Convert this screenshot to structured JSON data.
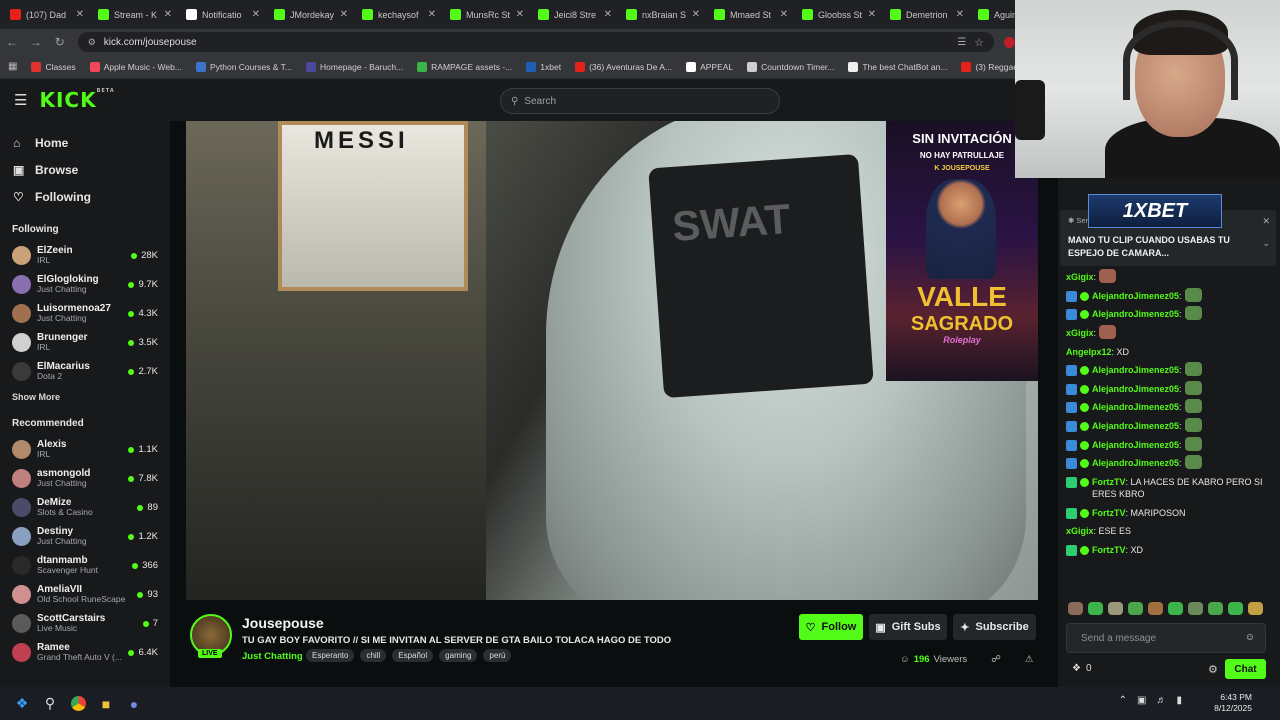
{
  "browser": {
    "tabs": [
      {
        "title": "(107) Dad",
        "color": "#e62117"
      },
      {
        "title": "Stream - K",
        "color": "#53fc18"
      },
      {
        "title": "Notificatio",
        "color": "#ffffff"
      },
      {
        "title": "JMordekay",
        "color": "#53fc18"
      },
      {
        "title": "kechaysof",
        "color": "#53fc18"
      },
      {
        "title": "MunsRc St",
        "color": "#53fc18"
      },
      {
        "title": "Jeici8 Stre",
        "color": "#53fc18"
      },
      {
        "title": "nxBraian S",
        "color": "#53fc18"
      },
      {
        "title": "Mmaed St",
        "color": "#53fc18"
      },
      {
        "title": "Gloobss St",
        "color": "#53fc18"
      },
      {
        "title": "Demetrion",
        "color": "#53fc18"
      },
      {
        "title": "Aguimer",
        "color": "#53fc18"
      }
    ],
    "url": "kick.com/jousepouse",
    "bookmarks": [
      {
        "label": "Classes",
        "color": "#e03030"
      },
      {
        "label": "Apple Music - Web...",
        "color": "#f0455a"
      },
      {
        "label": "Python Courses & T...",
        "color": "#3a73c9"
      },
      {
        "label": "Homepage - Baruch...",
        "color": "#4a4a9a"
      },
      {
        "label": "RAMPAGE assets -...",
        "color": "#3ab54a"
      },
      {
        "label": "1xbet",
        "color": "#1e5fb8"
      },
      {
        "label": "(36) Aventuras De A...",
        "color": "#e62117"
      },
      {
        "label": "APPEAL",
        "color": "#ffffff"
      },
      {
        "label": "Countdown Timer...",
        "color": "#cccccc"
      },
      {
        "label": "The best ChatBot an...",
        "color": "#eeeeee"
      },
      {
        "label": "(3) Reggaeton Nuev...",
        "color": "#e62117"
      }
    ]
  },
  "kick": {
    "logo": "KICK",
    "logo_beta": "BETA",
    "search_placeholder": "Search",
    "accent": "#53fc18"
  },
  "sidebar": {
    "nav": [
      {
        "label": "Home",
        "icon": "home-icon"
      },
      {
        "label": "Browse",
        "icon": "browse-icon"
      },
      {
        "label": "Following",
        "icon": "heart-icon"
      }
    ],
    "following_header": "Following",
    "following": [
      {
        "name": "ElZeein",
        "category": "IRL",
        "viewers": "28K",
        "color": "#c9a27a"
      },
      {
        "name": "ElGlogloking",
        "category": "Just Chatting",
        "viewers": "9.7K",
        "color": "#8a6fb0"
      },
      {
        "name": "Luisormenoa27",
        "category": "Just Chatting",
        "viewers": "4.3K",
        "color": "#a07050"
      },
      {
        "name": "Brunenger",
        "category": "IRL",
        "viewers": "3.5K",
        "color": "#d0d0d0"
      },
      {
        "name": "ElMacarius",
        "category": "Dota 2",
        "viewers": "2.7K",
        "color": "#3a3a3a"
      }
    ],
    "show_more": "Show More",
    "recommended_header": "Recommended",
    "recommended": [
      {
        "name": "Alexis",
        "category": "IRL",
        "viewers": "1.1K",
        "color": "#b08a6a"
      },
      {
        "name": "asmongold",
        "category": "Just Chatting",
        "viewers": "7.8K",
        "color": "#c08080"
      },
      {
        "name": "DeMize",
        "category": "Slots & Casino",
        "viewers": "89",
        "color": "#4a4a6a"
      },
      {
        "name": "Destiny",
        "category": "Just Chatting",
        "viewers": "1.2K",
        "color": "#8aa0c0"
      },
      {
        "name": "dtanmamb",
        "category": "Scavenger Hunt",
        "viewers": "366",
        "color": "#2a2a2a"
      },
      {
        "name": "AmeliaVII",
        "category": "Old School RuneScape",
        "viewers": "93",
        "color": "#d09090"
      },
      {
        "name": "ScottCarstairs",
        "category": "Live Music",
        "viewers": "7",
        "color": "#5a5a5a"
      },
      {
        "name": "Ramee",
        "category": "Grand Theft Auto V (...",
        "viewers": "6.4K",
        "color": "#c04050"
      }
    ]
  },
  "video": {
    "poster_text": "MESSI",
    "vest_text": "SWAT",
    "promo": {
      "line1": "SIN INVITACIÓN",
      "line2": "NO HAY PATRULLAJE",
      "brand": "K JOUSEPOUSE",
      "title1": "VALLE",
      "title2": "SAGRADO",
      "sub": "Roleplay"
    }
  },
  "channel": {
    "name": "Jousepouse",
    "live_label": "LIVE",
    "title": "TU GAY BOY FAVORITO // SI ME INVITAN AL SERVER DE GTA BAILO TOLACA HAGO DE TODO",
    "category": "Just Chatting",
    "tags": [
      "Esperanto",
      "chill",
      "Español",
      "gaming",
      "perú"
    ],
    "follow_label": "Follow",
    "gift_label": "Gift Subs",
    "subscribe_label": "Subscribe",
    "viewers": "196",
    "viewers_label": "Viewers"
  },
  "chat": {
    "pinned_label": "Ser",
    "pinned_text": "MANO TU CLIP CUANDO USABAS TU ESPEJO DE CAMARA...",
    "ad_text": "1XBET",
    "messages": [
      {
        "user": "xGigix",
        "text": "",
        "color": "#53fc18",
        "badge": "",
        "emote": "#a06050"
      },
      {
        "user": "AlejandroJimenez05",
        "text": "",
        "color": "#53fc18",
        "badge": "#3a8ad8",
        "emote": "#5a8a4a"
      },
      {
        "user": "AlejandroJimenez05",
        "text": "",
        "color": "#53fc18",
        "badge": "#3a8ad8",
        "emote": "#5a8a4a"
      },
      {
        "user": "xGigix",
        "text": "",
        "color": "#53fc18",
        "badge": "",
        "emote": "#a06050"
      },
      {
        "user": "Angelpx12",
        "text": "XD",
        "color": "#53fc18",
        "badge": "",
        "emote": ""
      },
      {
        "user": "AlejandroJimenez05",
        "text": "",
        "color": "#53fc18",
        "badge": "#3a8ad8",
        "emote": "#5a8a4a"
      },
      {
        "user": "AlejandroJimenez05",
        "text": "",
        "color": "#53fc18",
        "badge": "#3a8ad8",
        "emote": "#5a8a4a"
      },
      {
        "user": "AlejandroJimenez05",
        "text": "",
        "color": "#53fc18",
        "badge": "#3a8ad8",
        "emote": "#5a8a4a"
      },
      {
        "user": "AlejandroJimenez05",
        "text": "",
        "color": "#53fc18",
        "badge": "#3a8ad8",
        "emote": "#5a8a4a"
      },
      {
        "user": "AlejandroJimenez05",
        "text": "",
        "color": "#53fc18",
        "badge": "#3a8ad8",
        "emote": "#5a8a4a"
      },
      {
        "user": "AlejandroJimenez05",
        "text": "",
        "color": "#53fc18",
        "badge": "#3a8ad8",
        "emote": "#5a8a4a"
      },
      {
        "user": "FortzTV",
        "text": "LA HACES DE KABRO PERO SI ERES KBRO",
        "color": "#53fc18",
        "badge": "#2ecc71",
        "emote": ""
      },
      {
        "user": "FortzTV",
        "text": "MARIPOSON",
        "color": "#53fc18",
        "badge": "#2ecc71",
        "emote": ""
      },
      {
        "user": "xGigix",
        "text": "ESE ES",
        "color": "#53fc18",
        "badge": "",
        "emote": ""
      },
      {
        "user": "FortzTV",
        "text": "XD",
        "color": "#53fc18",
        "badge": "#2ecc71",
        "emote": ""
      }
    ],
    "send_placeholder": "Send a message",
    "points": "0",
    "chat_button": "Chat"
  },
  "taskbar": {
    "time": "6:43 PM",
    "date": "8/12/2025"
  }
}
